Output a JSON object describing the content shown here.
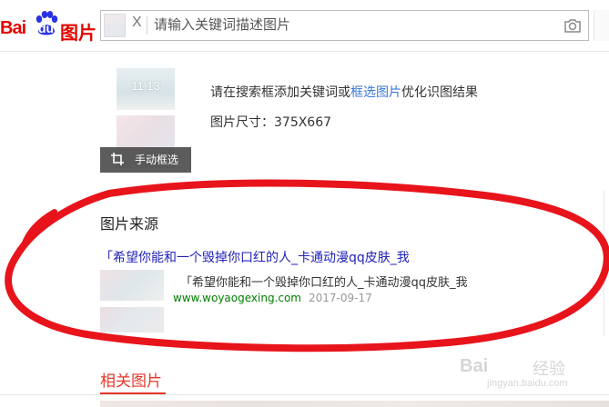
{
  "header": {
    "logo_text": "Bai du 图片",
    "logo_bai": "Bai",
    "logo_du": "du",
    "logo_tupian": "图片",
    "thumb_close": "X",
    "search_placeholder": "请输入关键词描述图片",
    "camera_icon": "camera-icon"
  },
  "query": {
    "thumb_time": "11:13",
    "crop_button_label": "手动框选",
    "hint_prefix": "请在搜索框添加关键词或",
    "hint_link": "框选图片",
    "hint_suffix": "优化识图结果",
    "size_label": "图片尺寸：375X667"
  },
  "source": {
    "title": "图片来源",
    "link_text": "「希望你能和一个毁掉你口红的人_卡通动漫qq皮肤_我",
    "description": "「希望你能和一个毁掉你口红的人_卡通动漫qq皮肤_我",
    "url": "www.woyaogexing.com",
    "date": "2017-09-17"
  },
  "related": {
    "tab_label": "相关图片"
  },
  "watermark": {
    "text": "Bai du 经验",
    "logo": "Bai",
    "jingyan": "经验",
    "url": "jingyan.baidu.com"
  },
  "colors": {
    "brand_red": "#e10602",
    "link_blue": "#3a79d6",
    "source_link": "#2223b8",
    "url_green": "#008000",
    "annotation_red": "#e8141b"
  }
}
